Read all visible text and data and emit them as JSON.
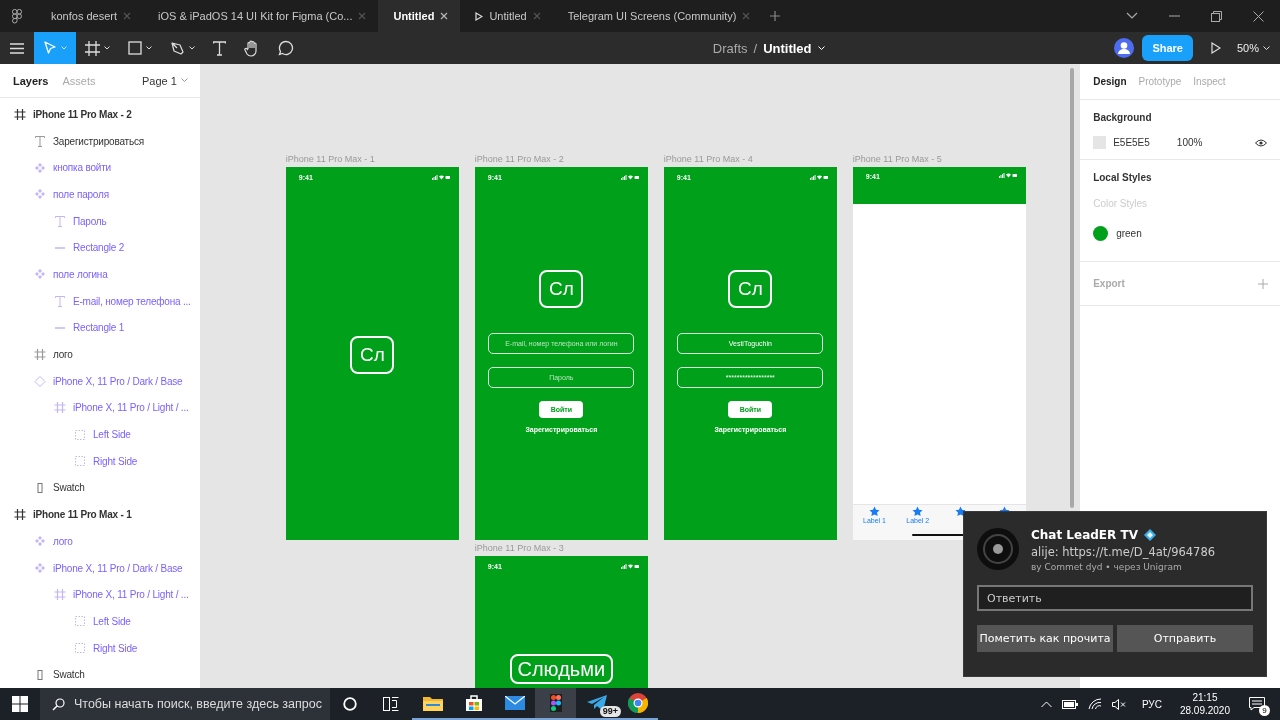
{
  "browser_tabs": [
    {
      "label": "konfos desert",
      "kind": "design",
      "selected": false
    },
    {
      "label": "iOS & iPadOS 14 UI Kit for Figma (Co...",
      "kind": "design",
      "selected": false
    },
    {
      "label": "Untitled",
      "kind": "design",
      "selected": true
    },
    {
      "label": "Untitled",
      "kind": "prototype",
      "selected": false
    },
    {
      "label": "Telegram UI Screens (Community)",
      "kind": "design",
      "selected": false
    }
  ],
  "tools": [
    {
      "kind": "move",
      "selected": true
    },
    {
      "kind": "frame",
      "selected": false
    },
    {
      "kind": "shape",
      "selected": false
    },
    {
      "kind": "pen",
      "selected": false
    },
    {
      "kind": "text",
      "selected": false
    },
    {
      "kind": "hand",
      "selected": false
    },
    {
      "kind": "comment",
      "selected": false
    }
  ],
  "breadcrumb": {
    "folder": "Drafts",
    "separator": "/",
    "file": "Untitled"
  },
  "share": "Share",
  "zoom": "50%",
  "left_panel": {
    "tabs": [
      {
        "label": "Layers",
        "selected": true
      },
      {
        "label": "Assets",
        "selected": false
      }
    ],
    "page": "Page 1",
    "layers": [
      {
        "name": "iPhone 11 Pro Max - 2",
        "kind": "frame",
        "component": false,
        "children": [
          {
            "name": "Зарегистрироваться",
            "kind": "text",
            "component": false
          },
          {
            "name": "кнопка войти",
            "kind": "component",
            "component": true
          },
          {
            "name": "поле пароля",
            "kind": "component",
            "component": true,
            "children": [
              {
                "name": "Пароль",
                "kind": "text",
                "component": true
              },
              {
                "name": "Rectangle 2",
                "kind": "line",
                "component": true
              }
            ]
          },
          {
            "name": "поле логина",
            "kind": "component",
            "component": true,
            "children": [
              {
                "name": "E-mail, номер телефона ...",
                "kind": "text",
                "component": true
              },
              {
                "name": "Rectangle 1",
                "kind": "line",
                "component": true
              }
            ]
          },
          {
            "name": "лого",
            "kind": "frame",
            "component": false
          },
          {
            "name": "iPhone X, 11 Pro / Dark / Base",
            "kind": "instance",
            "component": true,
            "children": [
              {
                "name": "iPhone X, 11 Pro / Light / ...",
                "kind": "frame",
                "component": true,
                "children": [
                  {
                    "name": "Left Side",
                    "kind": "slice",
                    "component": true
                  },
                  {
                    "name": "Right Side",
                    "kind": "slice",
                    "component": true
                  }
                ]
              }
            ]
          },
          {
            "name": "Swatch",
            "kind": "rectangle",
            "component": false
          }
        ]
      },
      {
        "name": "iPhone 11 Pro Max - 1",
        "kind": "frame",
        "component": false,
        "children": [
          {
            "name": "лого",
            "kind": "component",
            "component": true
          },
          {
            "name": "iPhone X, 11 Pro / Dark / Base",
            "kind": "component",
            "component": true,
            "children": [
              {
                "name": "iPhone X, 11 Pro / Light / ...",
                "kind": "frame",
                "component": true,
                "children": [
                  {
                    "name": "Left Side",
                    "kind": "slice",
                    "component": true
                  },
                  {
                    "name": "Right Side",
                    "kind": "slice",
                    "component": true
                  }
                ]
              }
            ]
          },
          {
            "name": "Swatch",
            "kind": "rectangle",
            "component": false
          }
        ]
      }
    ]
  },
  "frames": [
    {
      "label": "iPhone 11 Pro Max - 1",
      "kind": "splash",
      "time": "9:41",
      "logo": "Сл"
    },
    {
      "label": "iPhone 11 Pro Max - 2",
      "kind": "login",
      "time": "9:41",
      "logo": "Сл",
      "fields": [
        {
          "placeholder": "E-mail, номер телефона или логин"
        },
        {
          "placeholder": "Пароль"
        }
      ],
      "button": "Войти",
      "link": "Зарегистрироваться"
    },
    {
      "label": "iPhone 11 Pro Max - 4",
      "kind": "login",
      "time": "9:41",
      "logo": "Сл",
      "fields": [
        {
          "value": "VestiToguchin"
        },
        {
          "value": "******************"
        }
      ],
      "button": "Войти",
      "link": "Зарегистрироваться"
    },
    {
      "label": "iPhone 11 Pro Max - 5",
      "kind": "tabs",
      "time": "9:41",
      "tab_bar": [
        {
          "kind": "labeled",
          "label": "Label 1"
        },
        {
          "kind": "labeled",
          "label": "Label 2"
        },
        {
          "kind": "icon_only"
        },
        {
          "kind": "icon_only"
        }
      ]
    },
    {
      "label": "iPhone 11 Pro Max - 3",
      "kind": "brand",
      "time": "9:41",
      "title": "Слюдьми"
    }
  ],
  "right_panel": {
    "tabs": [
      {
        "label": "Design",
        "selected": true
      },
      {
        "label": "Prototype",
        "selected": false
      },
      {
        "label": "Inspect",
        "selected": false
      }
    ],
    "background": {
      "heading": "Background",
      "hex": "E5E5E5",
      "opacity": "100%",
      "color": "#e5e5e5"
    },
    "local_styles": {
      "heading": "Local Styles",
      "subheading": "Color Styles",
      "styles": [
        {
          "name": "green",
          "color": "#00a01a"
        }
      ]
    },
    "export": {
      "heading": "Export"
    }
  },
  "notification": {
    "title": "Chat LeadER TV",
    "message": "alije: https://t.me/D_4at/964786",
    "meta": "ву Commet dyd • через Unigram",
    "reply_placeholder": "Ответить",
    "buttons": [
      "Пометить как прочита",
      "Отправить"
    ]
  },
  "taskbar": {
    "search_placeholder": "Чтобы начать поиск, введите здесь запрос",
    "apps": [
      {
        "kind": "explorer",
        "selected": false
      },
      {
        "kind": "store",
        "selected": false
      },
      {
        "kind": "mail",
        "selected": false
      },
      {
        "kind": "figma",
        "selected": true
      },
      {
        "kind": "telegram",
        "selected": false,
        "badge": "99+"
      },
      {
        "kind": "chrome",
        "selected": false
      }
    ],
    "language": "РУС",
    "time": "21:15",
    "date": "28.09.2020",
    "notifications": "9"
  }
}
